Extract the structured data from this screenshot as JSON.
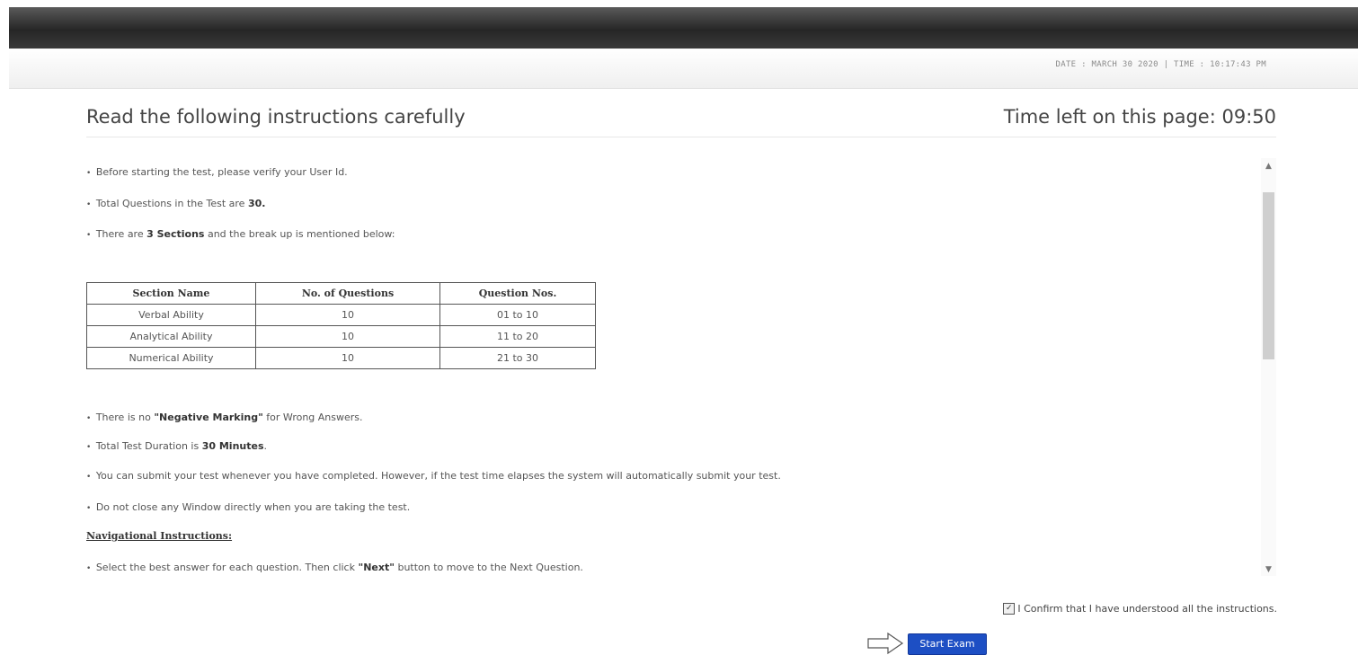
{
  "header": {
    "date_time": "DATE : MARCH 30 2020  |  TIME : 10:17:43 PM"
  },
  "page": {
    "heading": "Read the following instructions carefully",
    "time_left": "Time left on this page: 09:50"
  },
  "instructions": {
    "verify": "Before starting the test, please verify your User Id.",
    "total_q_prefix": "Total Questions in the Test are ",
    "total_q_value": "30.",
    "sections_prefix": "There are ",
    "sections_value": "3 Sections",
    "sections_suffix": " and the break up is mentioned below:",
    "neg_prefix": "There is no ",
    "neg_value": "\"Negative Marking\"",
    "neg_suffix": " for Wrong Answers.",
    "dur_prefix": "Total Test Duration is ",
    "dur_value": "30 Minutes",
    "dur_suffix": ".",
    "submit": "You can submit your test whenever you have completed. However, if the test time elapses the system will automatically submit your test.",
    "window": "Do not close any Window directly when you are taking the test.",
    "nav_heading": "Navigational Instructions:",
    "nav_prefix": "Select the best answer for each question. Then click ",
    "nav_value": "\"Next\"",
    "nav_suffix": " button to move to the Next Question."
  },
  "section_table": {
    "headers": [
      "Section Name",
      "No. of Questions",
      "Question Nos."
    ],
    "rows": [
      [
        "Verbal Ability",
        "10",
        "01 to 10"
      ],
      [
        "Analytical Ability",
        "10",
        "11 to 20"
      ],
      [
        "Numerical Ability",
        "10",
        "21 to 30"
      ]
    ]
  },
  "confirm": {
    "label": "I Confirm that I have understood all the instructions.",
    "checked": true
  },
  "start_button": {
    "label": "Start Exam"
  },
  "colors": {
    "topbar": "#2b2b2b",
    "start_button": "#1d4fc4"
  },
  "icons": {
    "scroll_up": "scroll-up-arrow-icon",
    "scroll_down": "scroll-down-arrow-icon",
    "pointer": "right-arrow-icon",
    "checkbox": "checkbox-checked-icon"
  }
}
